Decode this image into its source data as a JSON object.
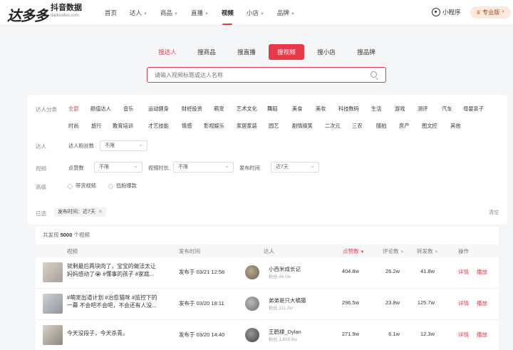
{
  "brand": {
    "logo": "达多多",
    "name": "抖音数据",
    "domain": "daduoduo.com"
  },
  "nav": [
    {
      "label": "首页",
      "arrow": false
    },
    {
      "label": "达人",
      "arrow": true
    },
    {
      "label": "商品",
      "arrow": true
    },
    {
      "label": "直播",
      "arrow": true
    },
    {
      "label": "视频",
      "arrow": false,
      "active": true
    },
    {
      "label": "小店",
      "arrow": true
    },
    {
      "label": "品牌",
      "arrow": true
    }
  ],
  "header_right": {
    "mini_program": "小程序",
    "pro": "专业版"
  },
  "search_tabs": [
    "搜达人",
    "搜商品",
    "搜直播",
    "搜视频",
    "搜小店",
    "搜品牌"
  ],
  "search": {
    "placeholder": "请输入视频标题或达人名称"
  },
  "filters": {
    "category_label": "达人分类",
    "categories_row1": [
      "全部",
      "颜值达人",
      "音乐",
      "运动健身",
      "财经投资",
      "萌宠",
      "艺术文化",
      "舞蹈",
      "美食",
      "美妆",
      "科技数码",
      "生活",
      "游戏",
      "测评",
      "汽车",
      "母婴亲子"
    ],
    "categories_row2": [
      "时尚",
      "旅行",
      "教育培训",
      "才艺技能",
      "情感",
      "影视娱乐",
      "家居家装",
      "园艺",
      "剧情搞笑",
      "二次元",
      "三农",
      "随拍",
      "房产",
      "图文控",
      "其他"
    ],
    "kol_label": "达人",
    "fans_label": "达人粉丝数",
    "fans_value": "不限",
    "video_label": "视频",
    "likes_label": "点赞数",
    "likes_value": "不限",
    "duration_label": "视频时长",
    "duration_value": "不限",
    "publish_label": "发布时间",
    "publish_value": "近7天",
    "advanced_label": "高级",
    "adv_opt1": "带货视频",
    "adv_opt2": "低粉爆款",
    "chosen_label": "已选",
    "chosen_tag_key": "发布时间：",
    "chosen_tag_value": "近7天",
    "clear_label": "清空"
  },
  "results": {
    "count_prefix": "共发现",
    "count": "5000",
    "count_suffix": "个视频",
    "columns": {
      "video": "视频",
      "time": "发布时间",
      "kol": "达人",
      "likes": "点赞数",
      "comments": "评论数",
      "shares": "转发数",
      "ops": "操作"
    },
    "rows": [
      {
        "title": "就剩最后两块肉了，宝宝的做法太让妈妈感动了😭 #懂事的孩子 #家庭...",
        "time": "发布于 03/21 12:58",
        "kol": "小西米成长记",
        "fans": "粉丝 46.0w",
        "likes": "404.8w",
        "comments": "26.2w",
        "shares": "41.8w",
        "op1": "详情",
        "op2": "播放"
      },
      {
        "title": "#萌宠出道计划 #治愈猫咪 #监控下的一幕 不会吧不会吧，不会还有人没...",
        "time": "发布于 03/20 18:11",
        "kol": "弟弟是只大橘猫",
        "fans": "粉丝 111.2w",
        "likes": "296.5w",
        "comments": "23.8w",
        "shares": "125.7w",
        "op1": "详情",
        "op2": "播放"
      },
      {
        "title": "今天没段子，今天杀青。",
        "time": "发布于 03/20 14:40",
        "kol": "王鹤棣_Dylan",
        "fans": "粉丝 1,659.8w",
        "likes": "271.9w",
        "comments": "6.1w",
        "shares": "12.3w",
        "op1": "详情",
        "op2": "播放"
      }
    ]
  }
}
